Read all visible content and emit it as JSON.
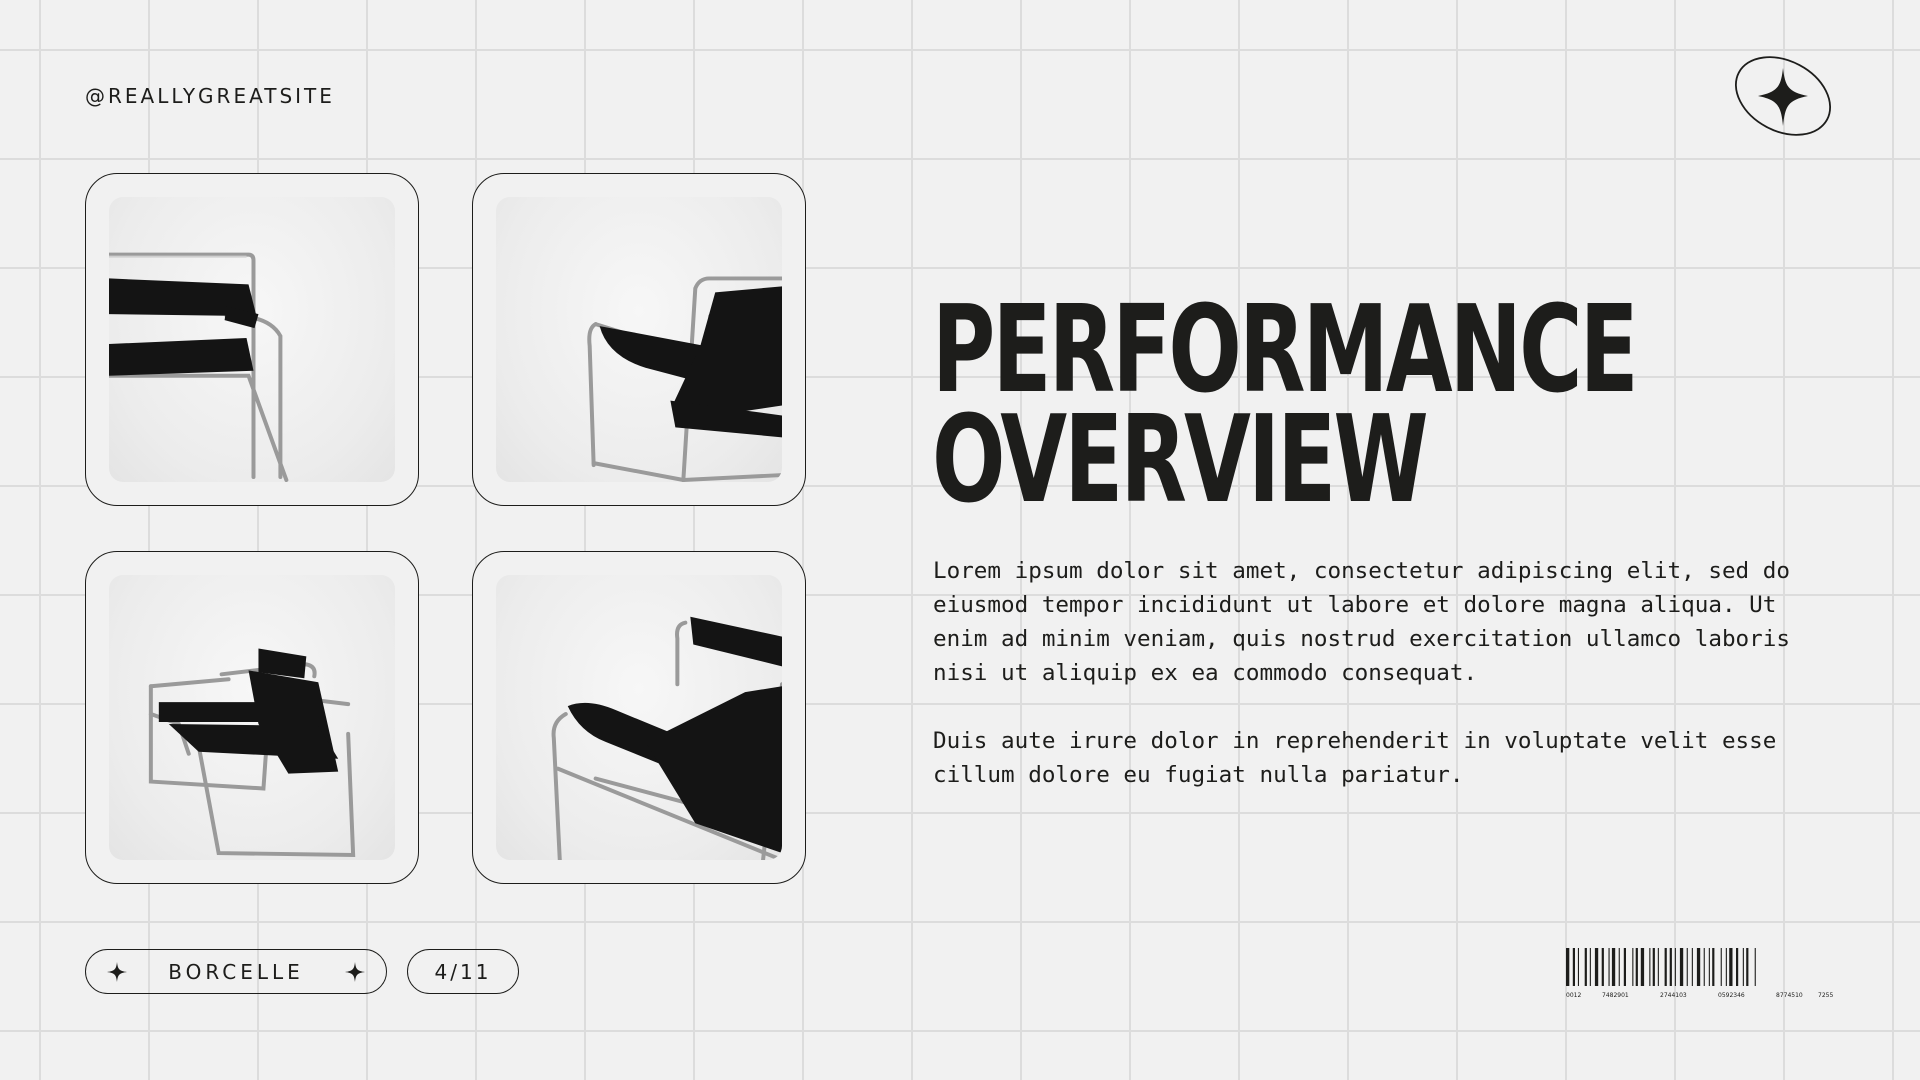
{
  "header": {
    "handle": "@REALLYGREATSITE"
  },
  "icons": {
    "badge": "four-point-star-in-ellipse-icon",
    "pill_stars": "four-point-star-icon"
  },
  "gallery": [
    {
      "name": "chair-photo-1",
      "alt": "chair"
    },
    {
      "name": "chair-photo-2",
      "alt": "chair"
    },
    {
      "name": "chair-photo-3",
      "alt": "chair"
    },
    {
      "name": "chair-photo-4",
      "alt": "chair"
    }
  ],
  "content": {
    "title_line1": "PERFORMANCE",
    "title_line2": "OVERVIEW",
    "paragraph1": "Lorem ipsum dolor sit amet, consectetur adipiscing elit, sed do eiusmod tempor incididunt ut labore et dolore magna aliqua. Ut enim ad minim veniam, quis nostrud exercitation ullamco laboris nisi ut aliquip ex ea commodo consequat.",
    "paragraph2": "Duis aute irure dolor in reprehenderit in voluptate velit esse cillum dolore eu fugiat nulla pariatur."
  },
  "footer": {
    "brand": "BORCELLE",
    "page": "4/11",
    "barcode_numbers": [
      "0012",
      "7482901",
      "2744103",
      "0592346",
      "8774510",
      "7255"
    ]
  },
  "colors": {
    "background": "#f1f1f1",
    "ink": "#1d1d1b",
    "grid": "#dcdcdc"
  }
}
